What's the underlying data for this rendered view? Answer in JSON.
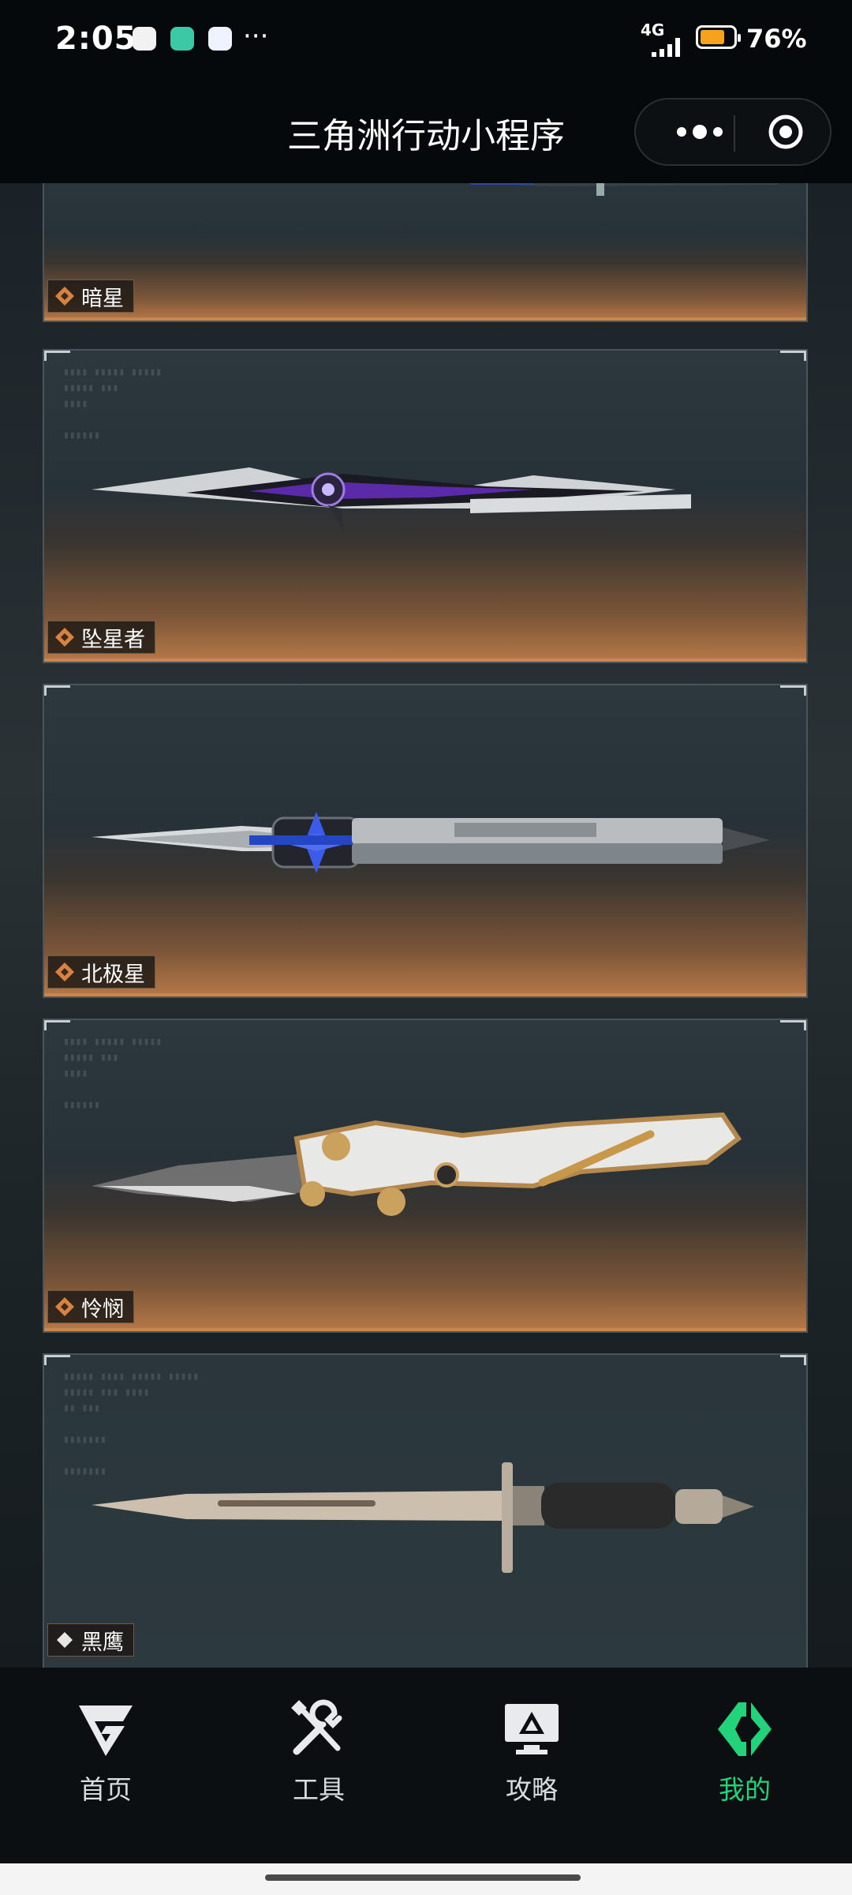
{
  "status": {
    "time": "2:05",
    "network": "4G",
    "battery_percent": "76%",
    "battery_level": 0.76,
    "overflow": "···",
    "colors": {
      "battery": "#f6a21c"
    }
  },
  "header": {
    "title": "三角洲行动小程序"
  },
  "items": [
    {
      "name": "暗星",
      "rarity_icon": "orange-diamond-icon"
    },
    {
      "name": "坠星者",
      "rarity_icon": "orange-diamond-icon"
    },
    {
      "name": "北极星",
      "rarity_icon": "orange-diamond-icon"
    },
    {
      "name": "怜悯",
      "rarity_icon": "orange-diamond-icon"
    },
    {
      "name": "黑鹰",
      "rarity_icon": "white-diamond-icon"
    }
  ],
  "tabs": [
    {
      "label": "首页",
      "icon": "home-g-logo-icon",
      "active": false
    },
    {
      "label": "工具",
      "icon": "tools-icon",
      "active": false
    },
    {
      "label": "攻略",
      "icon": "guide-monitor-icon",
      "active": false
    },
    {
      "label": "我的",
      "icon": "profile-logo-icon",
      "active": true
    }
  ],
  "colors": {
    "active_tab": "#22d37c",
    "card_accent": "#c9874f"
  }
}
